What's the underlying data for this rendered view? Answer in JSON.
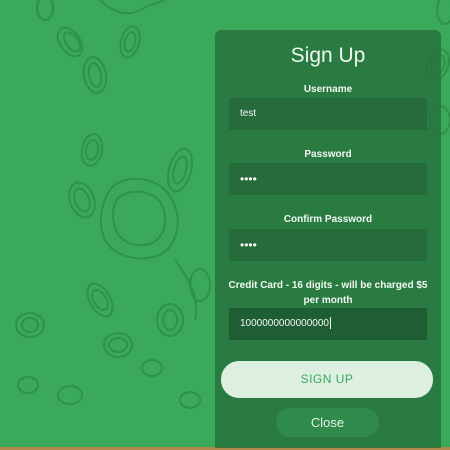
{
  "form": {
    "title": "Sign Up",
    "username_label": "Username",
    "username_value": "test",
    "password_label": "Password",
    "password_value": "••••",
    "confirm_label": "Confirm Password",
    "confirm_value": "••••",
    "card_label": "Credit Card - 16 digits - will be charged $5 per month",
    "card_value": "1000000000000000",
    "signup_label": "SIGN UP",
    "close_label": "Close"
  },
  "colors": {
    "background": "#3aaa5a",
    "panel": "#266e3a",
    "field": "#256b3b",
    "signup_button": "#dcefe0",
    "close_button": "#2f8a4c"
  }
}
